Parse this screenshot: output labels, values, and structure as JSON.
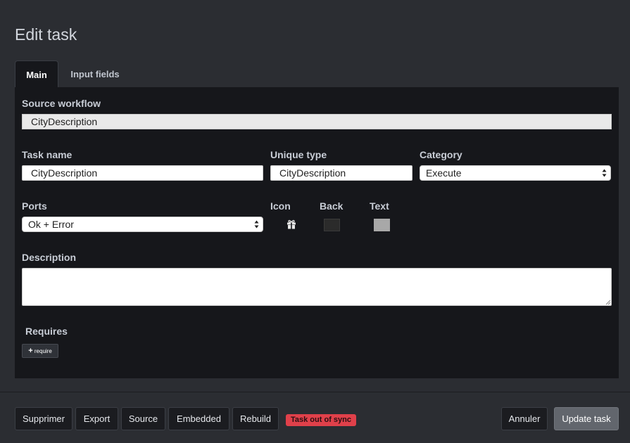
{
  "dialog": {
    "title": "Edit task",
    "tabs": [
      {
        "label": "Main",
        "active": true
      },
      {
        "label": "Input fields",
        "active": false
      }
    ]
  },
  "form": {
    "source_workflow": {
      "label": "Source workflow",
      "value": "CityDescription"
    },
    "task_name": {
      "label": "Task name",
      "value": "CityDescription"
    },
    "unique_type": {
      "label": "Unique type",
      "value": "CityDescription"
    },
    "category": {
      "label": "Category",
      "value": "Execute"
    },
    "ports": {
      "label": "Ports",
      "value": "Ok + Error"
    },
    "icon": {
      "label": "Icon",
      "icon_name": "gift-icon"
    },
    "back": {
      "label": "Back",
      "color": "#2b2b2b"
    },
    "text": {
      "label": "Text",
      "color": "#a8a8a8"
    },
    "description": {
      "label": "Description",
      "value": ""
    },
    "requires": {
      "label": "Requires",
      "button_label": "require"
    }
  },
  "footer": {
    "buttons": [
      "Supprimer",
      "Export",
      "Source",
      "Embedded",
      "Rebuild"
    ],
    "status_badge": "Task out of sync",
    "cancel_label": "Annuler",
    "update_label": "Update task"
  },
  "colors": {
    "panel": "#16171b",
    "badge": "#e0404a",
    "primary_button": "#62666d"
  }
}
